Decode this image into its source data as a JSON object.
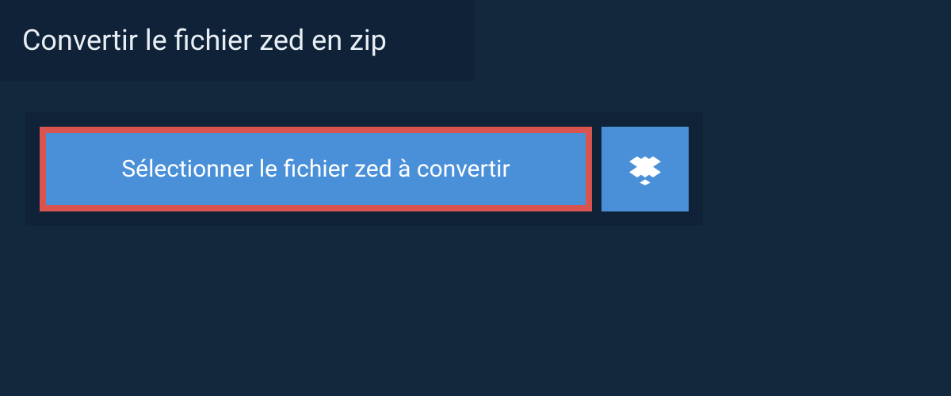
{
  "header": {
    "title": "Convertir le fichier zed en zip"
  },
  "upload": {
    "select_button_label": "Sélectionner le fichier zed à convertir"
  }
}
